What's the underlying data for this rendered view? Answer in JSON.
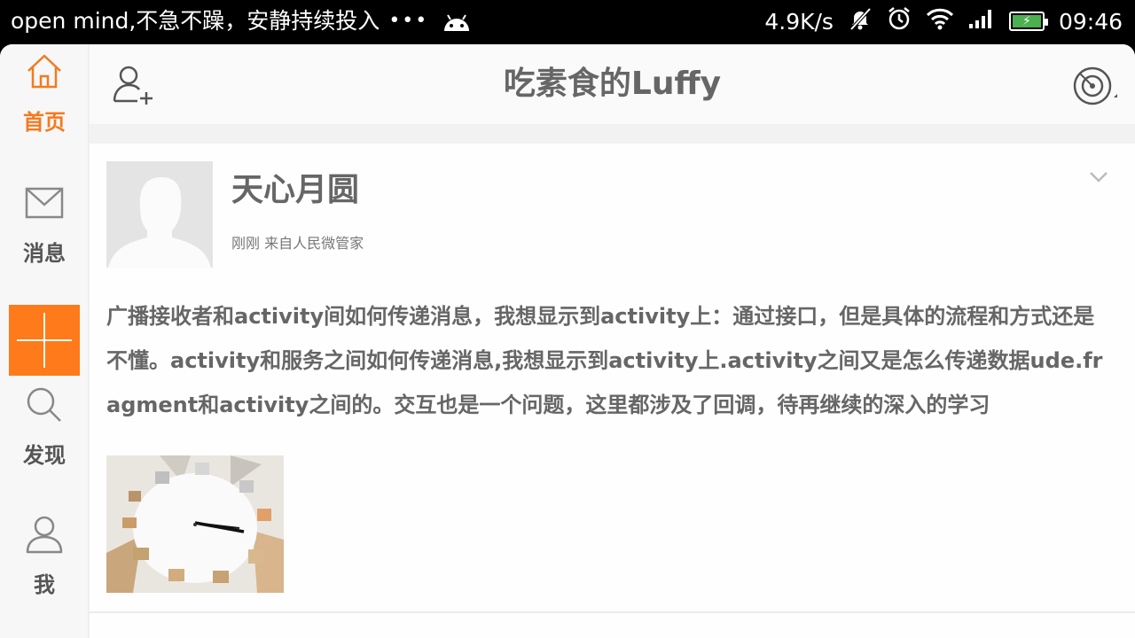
{
  "status_bar": {
    "notification_text": "open mind,不急不躁，安静持续投入",
    "overflow": "•••",
    "net_speed": "4.9K/s",
    "time": "09:46",
    "icons": [
      "android-icon",
      "mute-icon",
      "alarm-icon",
      "wifi-icon",
      "signal-icon",
      "battery-icon"
    ]
  },
  "nav": {
    "items": [
      {
        "label": "首页",
        "icon": "home-icon",
        "active": true
      },
      {
        "label": "消息",
        "icon": "mail-icon",
        "active": false
      },
      {
        "label": "发现",
        "icon": "search-icon",
        "active": false
      },
      {
        "label": "我",
        "icon": "user-icon",
        "active": false
      }
    ],
    "compose_icon": "plus-icon"
  },
  "header": {
    "title": "吃素食的Luffy",
    "left_icon": "add-friend-icon",
    "right_icon": "radar-icon"
  },
  "post": {
    "author": "天心月圆",
    "meta": "刚刚 来自人民微管家",
    "text": "广播接收者和activity间如何传递消息，我想显示到activity上：通过接口，但是具体的流程和方式还是不懂。activity和服务之间如何传递消息,我想显示到activity上.activity之间又是怎么传递数据ude.fragment和activity之间的。交互也是一个问题，这里都涉及了回调，待再继续的深入的学习",
    "image_icon": "clock-image"
  },
  "colors": {
    "accent": "#ff7a1a",
    "active_label": "#f47a1f",
    "text": "#666666"
  }
}
